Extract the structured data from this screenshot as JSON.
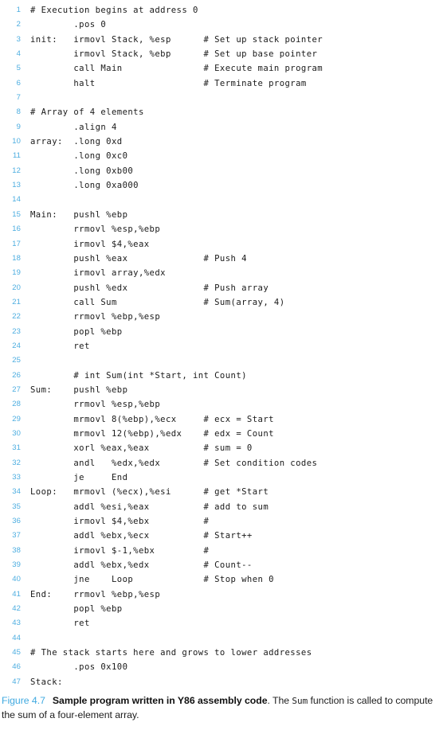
{
  "figure": {
    "label": "Figure 4.7",
    "title": "Sample program written in Y86 assembly code",
    "caption_part1": ". The ",
    "caption_mono": "Sum",
    "caption_part2": " function is called to compute the sum of a four-element array.",
    "label_color": "#3fa9e0",
    "line_number_color": "#4cade0",
    "code_color": "#1a1a1a",
    "background_color": "#ffffff"
  },
  "code": {
    "language": "Y86 assembly",
    "first_line_number": 1,
    "last_line_number": 47,
    "lines": [
      {
        "n": "1",
        "text": "# Execution begins at address 0"
      },
      {
        "n": "2",
        "text": "        .pos 0"
      },
      {
        "n": "3",
        "text": "init:   irmovl Stack, %esp      # Set up stack pointer"
      },
      {
        "n": "4",
        "text": "        irmovl Stack, %ebp      # Set up base pointer"
      },
      {
        "n": "5",
        "text": "        call Main               # Execute main program"
      },
      {
        "n": "6",
        "text": "        halt                    # Terminate program"
      },
      {
        "n": "7",
        "text": ""
      },
      {
        "n": "8",
        "text": "# Array of 4 elements"
      },
      {
        "n": "9",
        "text": "        .align 4"
      },
      {
        "n": "10",
        "text": "array:  .long 0xd"
      },
      {
        "n": "11",
        "text": "        .long 0xc0"
      },
      {
        "n": "12",
        "text": "        .long 0xb00"
      },
      {
        "n": "13",
        "text": "        .long 0xa000"
      },
      {
        "n": "14",
        "text": ""
      },
      {
        "n": "15",
        "text": "Main:   pushl %ebp"
      },
      {
        "n": "16",
        "text": "        rrmovl %esp,%ebp"
      },
      {
        "n": "17",
        "text": "        irmovl $4,%eax"
      },
      {
        "n": "18",
        "text": "        pushl %eax              # Push 4"
      },
      {
        "n": "19",
        "text": "        irmovl array,%edx"
      },
      {
        "n": "20",
        "text": "        pushl %edx              # Push array"
      },
      {
        "n": "21",
        "text": "        call Sum                # Sum(array, 4)"
      },
      {
        "n": "22",
        "text": "        rrmovl %ebp,%esp"
      },
      {
        "n": "23",
        "text": "        popl %ebp"
      },
      {
        "n": "24",
        "text": "        ret"
      },
      {
        "n": "25",
        "text": ""
      },
      {
        "n": "26",
        "text": "        # int Sum(int *Start, int Count)"
      },
      {
        "n": "27",
        "text": "Sum:    pushl %ebp"
      },
      {
        "n": "28",
        "text": "        rrmovl %esp,%ebp"
      },
      {
        "n": "29",
        "text": "        mrmovl 8(%ebp),%ecx     # ecx = Start"
      },
      {
        "n": "30",
        "text": "        mrmovl 12(%ebp),%edx    # edx = Count"
      },
      {
        "n": "31",
        "text": "        xorl %eax,%eax          # sum = 0"
      },
      {
        "n": "32",
        "text": "        andl   %edx,%edx        # Set condition codes"
      },
      {
        "n": "33",
        "text": "        je     End"
      },
      {
        "n": "34",
        "text": "Loop:   mrmovl (%ecx),%esi      # get *Start"
      },
      {
        "n": "35",
        "text": "        addl %esi,%eax          # add to sum"
      },
      {
        "n": "36",
        "text": "        irmovl $4,%ebx          #"
      },
      {
        "n": "37",
        "text": "        addl %ebx,%ecx          # Start++"
      },
      {
        "n": "38",
        "text": "        irmovl $-1,%ebx         #"
      },
      {
        "n": "39",
        "text": "        addl %ebx,%edx          # Count--"
      },
      {
        "n": "40",
        "text": "        jne    Loop             # Stop when 0"
      },
      {
        "n": "41",
        "text": "End:    rrmovl %ebp,%esp"
      },
      {
        "n": "42",
        "text": "        popl %ebp"
      },
      {
        "n": "43",
        "text": "        ret"
      },
      {
        "n": "44",
        "text": ""
      },
      {
        "n": "45",
        "text": "# The stack starts here and grows to lower addresses"
      },
      {
        "n": "46",
        "text": "        .pos 0x100"
      },
      {
        "n": "47",
        "text": "Stack:"
      }
    ]
  }
}
